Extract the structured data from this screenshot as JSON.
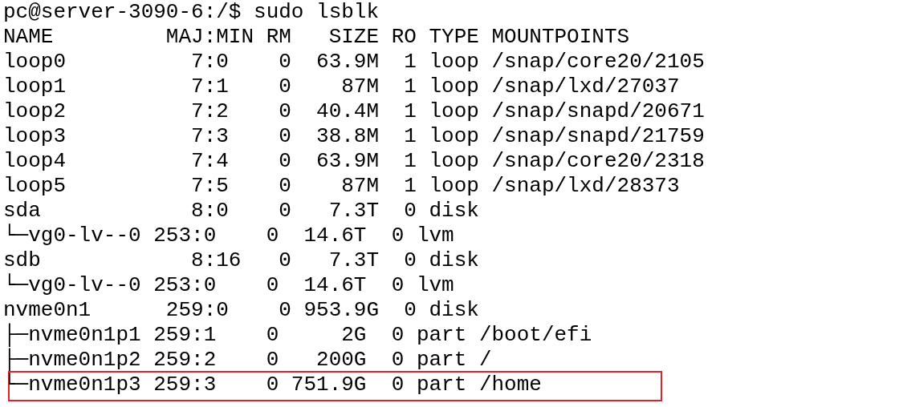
{
  "terminal": {
    "lines": [
      {
        "text": "pc@server-3090-6:/$ sudo lsblk",
        "highlighted": false
      },
      {
        "text": "NAME         MAJ:MIN RM   SIZE RO TYPE MOUNTPOINTS",
        "highlighted": false
      },
      {
        "text": "loop0          7:0    0  63.9M  1 loop /snap/core20/2105",
        "highlighted": false
      },
      {
        "text": "loop1          7:1    0    87M  1 loop /snap/lxd/27037",
        "highlighted": false
      },
      {
        "text": "loop2          7:2    0  40.4M  1 loop /snap/snapd/20671",
        "highlighted": false
      },
      {
        "text": "loop3          7:3    0  38.8M  1 loop /snap/snapd/21759",
        "highlighted": false
      },
      {
        "text": "loop4          7:4    0  63.9M  1 loop /snap/core20/2318",
        "highlighted": false
      },
      {
        "text": "loop5          7:5    0    87M  1 loop /snap/lxd/28373",
        "highlighted": false
      },
      {
        "text": "sda            8:0    0   7.3T  0 disk",
        "highlighted": false
      },
      {
        "text": "└─vg0-lv--0 253:0    0  14.6T  0 lvm",
        "highlighted": false
      },
      {
        "text": "sdb            8:16   0   7.3T  0 disk",
        "highlighted": false
      },
      {
        "text": "└─vg0-lv--0 253:0    0  14.6T  0 lvm",
        "highlighted": false
      },
      {
        "text": "nvme0n1      259:0    0 953.9G  0 disk",
        "highlighted": false
      },
      {
        "text": "├─nvme0n1p1 259:1    0     2G  0 part /boot/efi",
        "highlighted": false
      },
      {
        "text": "├─nvme0n1p2 259:2    0   200G  0 part /",
        "highlighted": false
      },
      {
        "text": "└─nvme0n1p3 259:3    0 751.9G  0 part /home",
        "highlighted": true
      }
    ]
  }
}
